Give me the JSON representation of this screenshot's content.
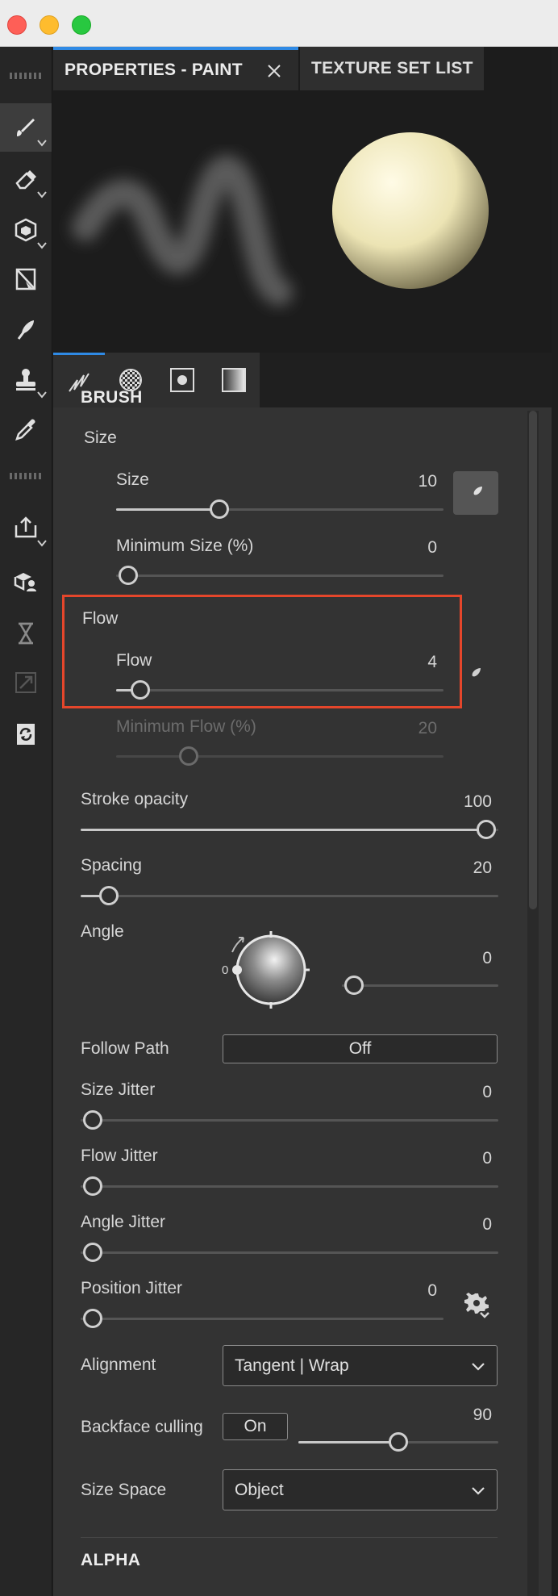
{
  "tabs": [
    {
      "label": "PROPERTIES - PAINT",
      "active": true
    },
    {
      "label": "TEXTURE SET LIST",
      "active": false
    }
  ],
  "toolbar": {
    "tools": [
      "paint-brush",
      "eraser",
      "projection",
      "polygon-fill",
      "smudge",
      "clone-stamp",
      "color-picker",
      "export",
      "bake",
      "time-machine",
      "resize",
      "sync"
    ]
  },
  "brush": {
    "section_title": "BRUSH",
    "size_group_label": "Size",
    "size": {
      "label": "Size",
      "value": "10",
      "fraction": 0.3
    },
    "min_size": {
      "label": "Minimum Size (%)",
      "value": "0",
      "fraction": 0.0
    },
    "flow_group_label": "Flow",
    "flow": {
      "label": "Flow",
      "value": "4",
      "fraction": 0.04
    },
    "min_flow": {
      "label": "Minimum Flow (%)",
      "value": "20",
      "fraction": 0.2
    },
    "stroke_opacity": {
      "label": "Stroke opacity",
      "value": "100",
      "fraction": 1.0
    },
    "spacing": {
      "label": "Spacing",
      "value": "20",
      "fraction": 0.04
    },
    "angle": {
      "label": "Angle",
      "value": "0",
      "dial_label": "0",
      "fraction": 0.0
    },
    "follow_path": {
      "label": "Follow Path",
      "value": "Off"
    },
    "size_jitter": {
      "label": "Size Jitter",
      "value": "0",
      "fraction": 0.0
    },
    "flow_jitter": {
      "label": "Flow Jitter",
      "value": "0",
      "fraction": 0.0
    },
    "angle_jitter": {
      "label": "Angle Jitter",
      "value": "0",
      "fraction": 0.0
    },
    "position_jitter": {
      "label": "Position Jitter",
      "value": "0",
      "fraction": 0.0
    },
    "alignment": {
      "label": "Alignment",
      "value": "Tangent | Wrap"
    },
    "backface_culling": {
      "label": "Backface culling",
      "toggle": "On",
      "value": "90",
      "fraction": 0.5
    },
    "size_space": {
      "label": "Size Space",
      "value": "Object"
    }
  },
  "alpha": {
    "section_title": "ALPHA"
  },
  "colors": {
    "accent": "#2f8ae5",
    "highlight": "#e5462b",
    "panel": "#333333"
  }
}
